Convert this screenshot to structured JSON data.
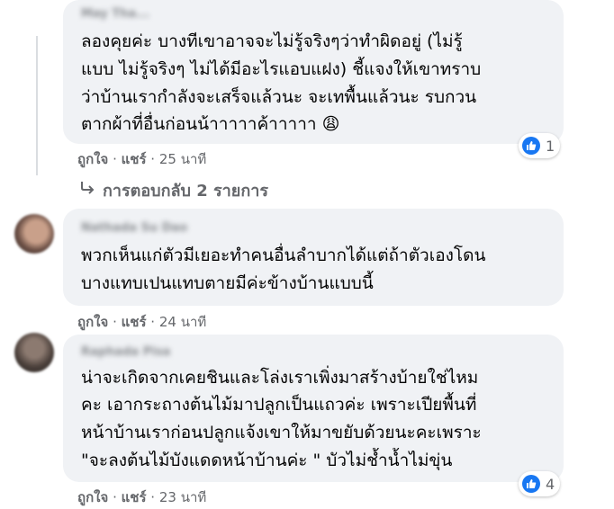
{
  "comments": [
    {
      "author": "May Tha...",
      "lines": [
        "ลองคุยค่ะ บางทีเขาอาจจะไม่รู้จริงๆว่าทำผิดอยู่ (ไม่รู้",
        "แบบ ไม่รู้จริงๆ ไม่ได้มีอะไรแอบแฝง) ชี้แจงให้เขาทราบ",
        "ว่าบ้านเรากำลังจะเสร็จแล้วนะ จะเทพื้นแล้วนะ รบกวน",
        "ตากผ้าที่อื่นก่อนน้าาาาาค้าาาาา 😩"
      ],
      "like": "ถูกใจ",
      "share": "แชร์",
      "time": "25 นาที",
      "reaction_count": "1"
    },
    {
      "author": "Nathada Su Dao",
      "lines": [
        "พวกเห็นแก่ตัวมีเยอะทำคนอื่นลำบากได้แต่ถ้าตัวเองโดน",
        "บางแทบเปนแทบตายมีค่ะข้างบ้านแบบนี้"
      ],
      "like": "ถูกใจ",
      "share": "แชร์",
      "time": "24 นาที"
    },
    {
      "author": "Raphada Pisa",
      "lines": [
        "น่าจะเกิดจากเคยชินและโล่งเราเพิ่งมาสร้างบ้ายใช่ไหม",
        "คะ เอากระถางต้นไม้มาปลูกเป็นแถวค่ะ เพราะเปียพื้นที่",
        "หน้าบ้านเราก่อนปลูกแจ้งเขาให้มาขยับด้วยนะคะเพราะ",
        "\"จะลงต้นไม้บังแดดหน้าบ้านค่ะ \" บัวไม่ช้ำน้ำไม่ขุ่น"
      ],
      "like": "ถูกใจ",
      "share": "แชร์",
      "time": "23 นาที",
      "reaction_count": "4"
    }
  ],
  "replies_link": "การตอบกลับ 2 รายการ",
  "colors": {
    "bubble": "#f0f2f5",
    "meta": "#65676b",
    "like_blue": "#1877f2"
  },
  "icons": {
    "reaction": "like-icon",
    "replies": "reply-arrow-icon"
  }
}
